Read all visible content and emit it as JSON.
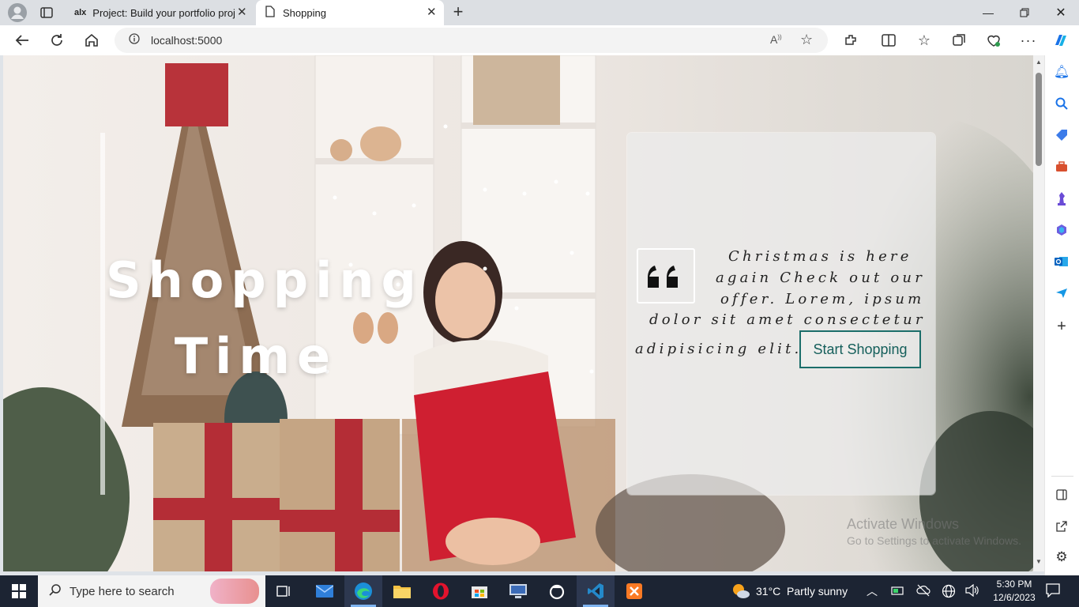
{
  "browser": {
    "tabs": [
      {
        "label": "Project: Build your portfolio proje",
        "favicon": "alx-logo"
      },
      {
        "label": "Shopping",
        "favicon": "page-icon"
      }
    ],
    "url": "localhost:5000"
  },
  "hero": {
    "title_line1": "Shopping",
    "title_line2": "Time",
    "quote_icon": "quote-mark-icon",
    "quote_lines": [
      "Christmas is here",
      "again Check out our",
      "offer. Lorem, ipsum",
      "dolor sit amet consectetur",
      "adipisicing elit."
    ],
    "button_label": "Start Shopping"
  },
  "watermark": {
    "title": "Activate Windows",
    "subtitle": "Go to Settings to activate Windows."
  },
  "taskbar": {
    "search_placeholder": "Type here to search",
    "weather": "31°C  Partly sunny",
    "time": "5:30 PM",
    "date": "12/6/2023"
  },
  "colors": {
    "accent_teal": "#1b6e6a",
    "taskbar_bg": "#1c2433",
    "edge_blue": "#1a73e8"
  }
}
